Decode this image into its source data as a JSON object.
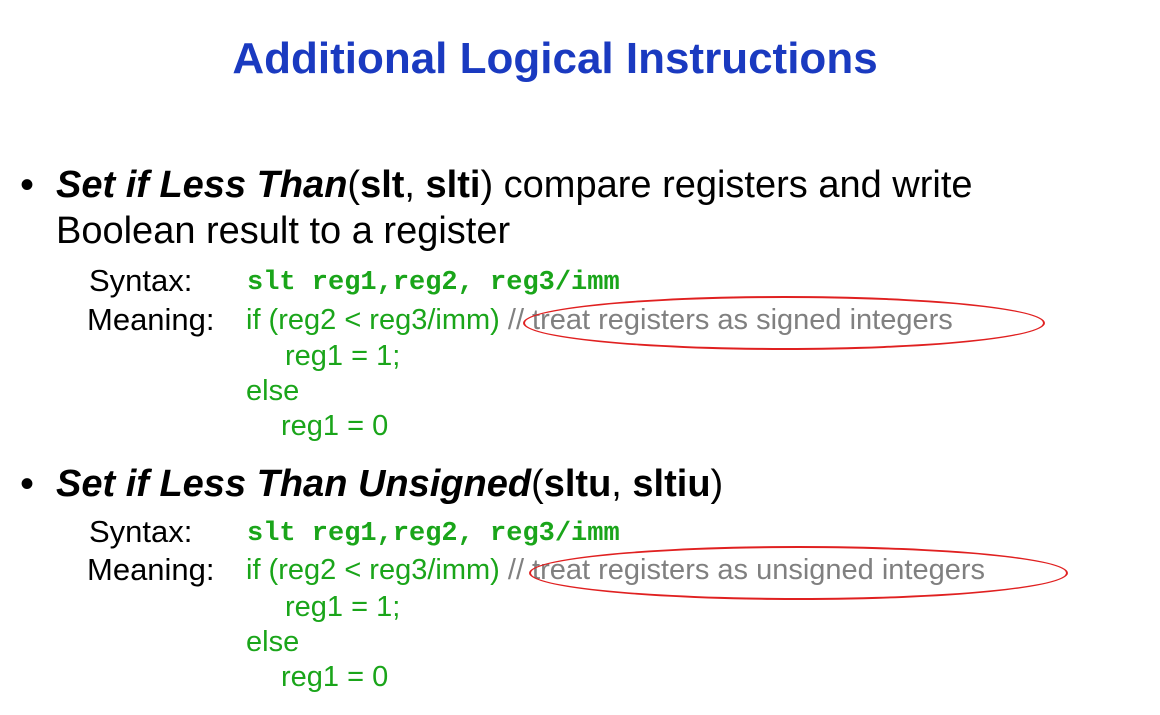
{
  "title": "Additional Logical Instructions",
  "bullets": [
    {
      "dot": "•",
      "name_italic": "Set if Less Than",
      "open_paren": "(",
      "mnemonic1": "slt",
      "comma": ", ",
      "mnemonic2": "slti",
      "close_and_desc": ") compare registers and write",
      "desc_line2": "Boolean result to a register",
      "syntax_label": "Syntax:",
      "syntax_code": "slt reg1,reg2, reg3/imm",
      "meaning_label": "Meaning:",
      "meaning_if": "if (reg2 < reg3/imm) ",
      "meaning_comment": "// treat registers as signed integers",
      "then_line": "reg1 = 1;",
      "else_line": "else",
      "else_body": "reg1 = 0"
    },
    {
      "dot": "•",
      "name_italic": "Set if Less Than Unsigned",
      "open_paren": "(",
      "mnemonic1": "sltu",
      "comma": ", ",
      "mnemonic2": "sltiu",
      "close_and_desc": ")",
      "syntax_label": "Syntax:",
      "syntax_code": "slt reg1,reg2, reg3/imm",
      "meaning_label": "Meaning:",
      "meaning_if": "if (reg2 < reg3/imm) ",
      "meaning_comment": "// treat registers as unsigned integers",
      "then_line": "reg1 = 1;",
      "else_line": "else",
      "else_body": "reg1 = 0"
    }
  ],
  "colors": {
    "title": "#1a3ac0",
    "code": "#1aa51a",
    "comment": "#808080",
    "highlight": "#e02020"
  }
}
